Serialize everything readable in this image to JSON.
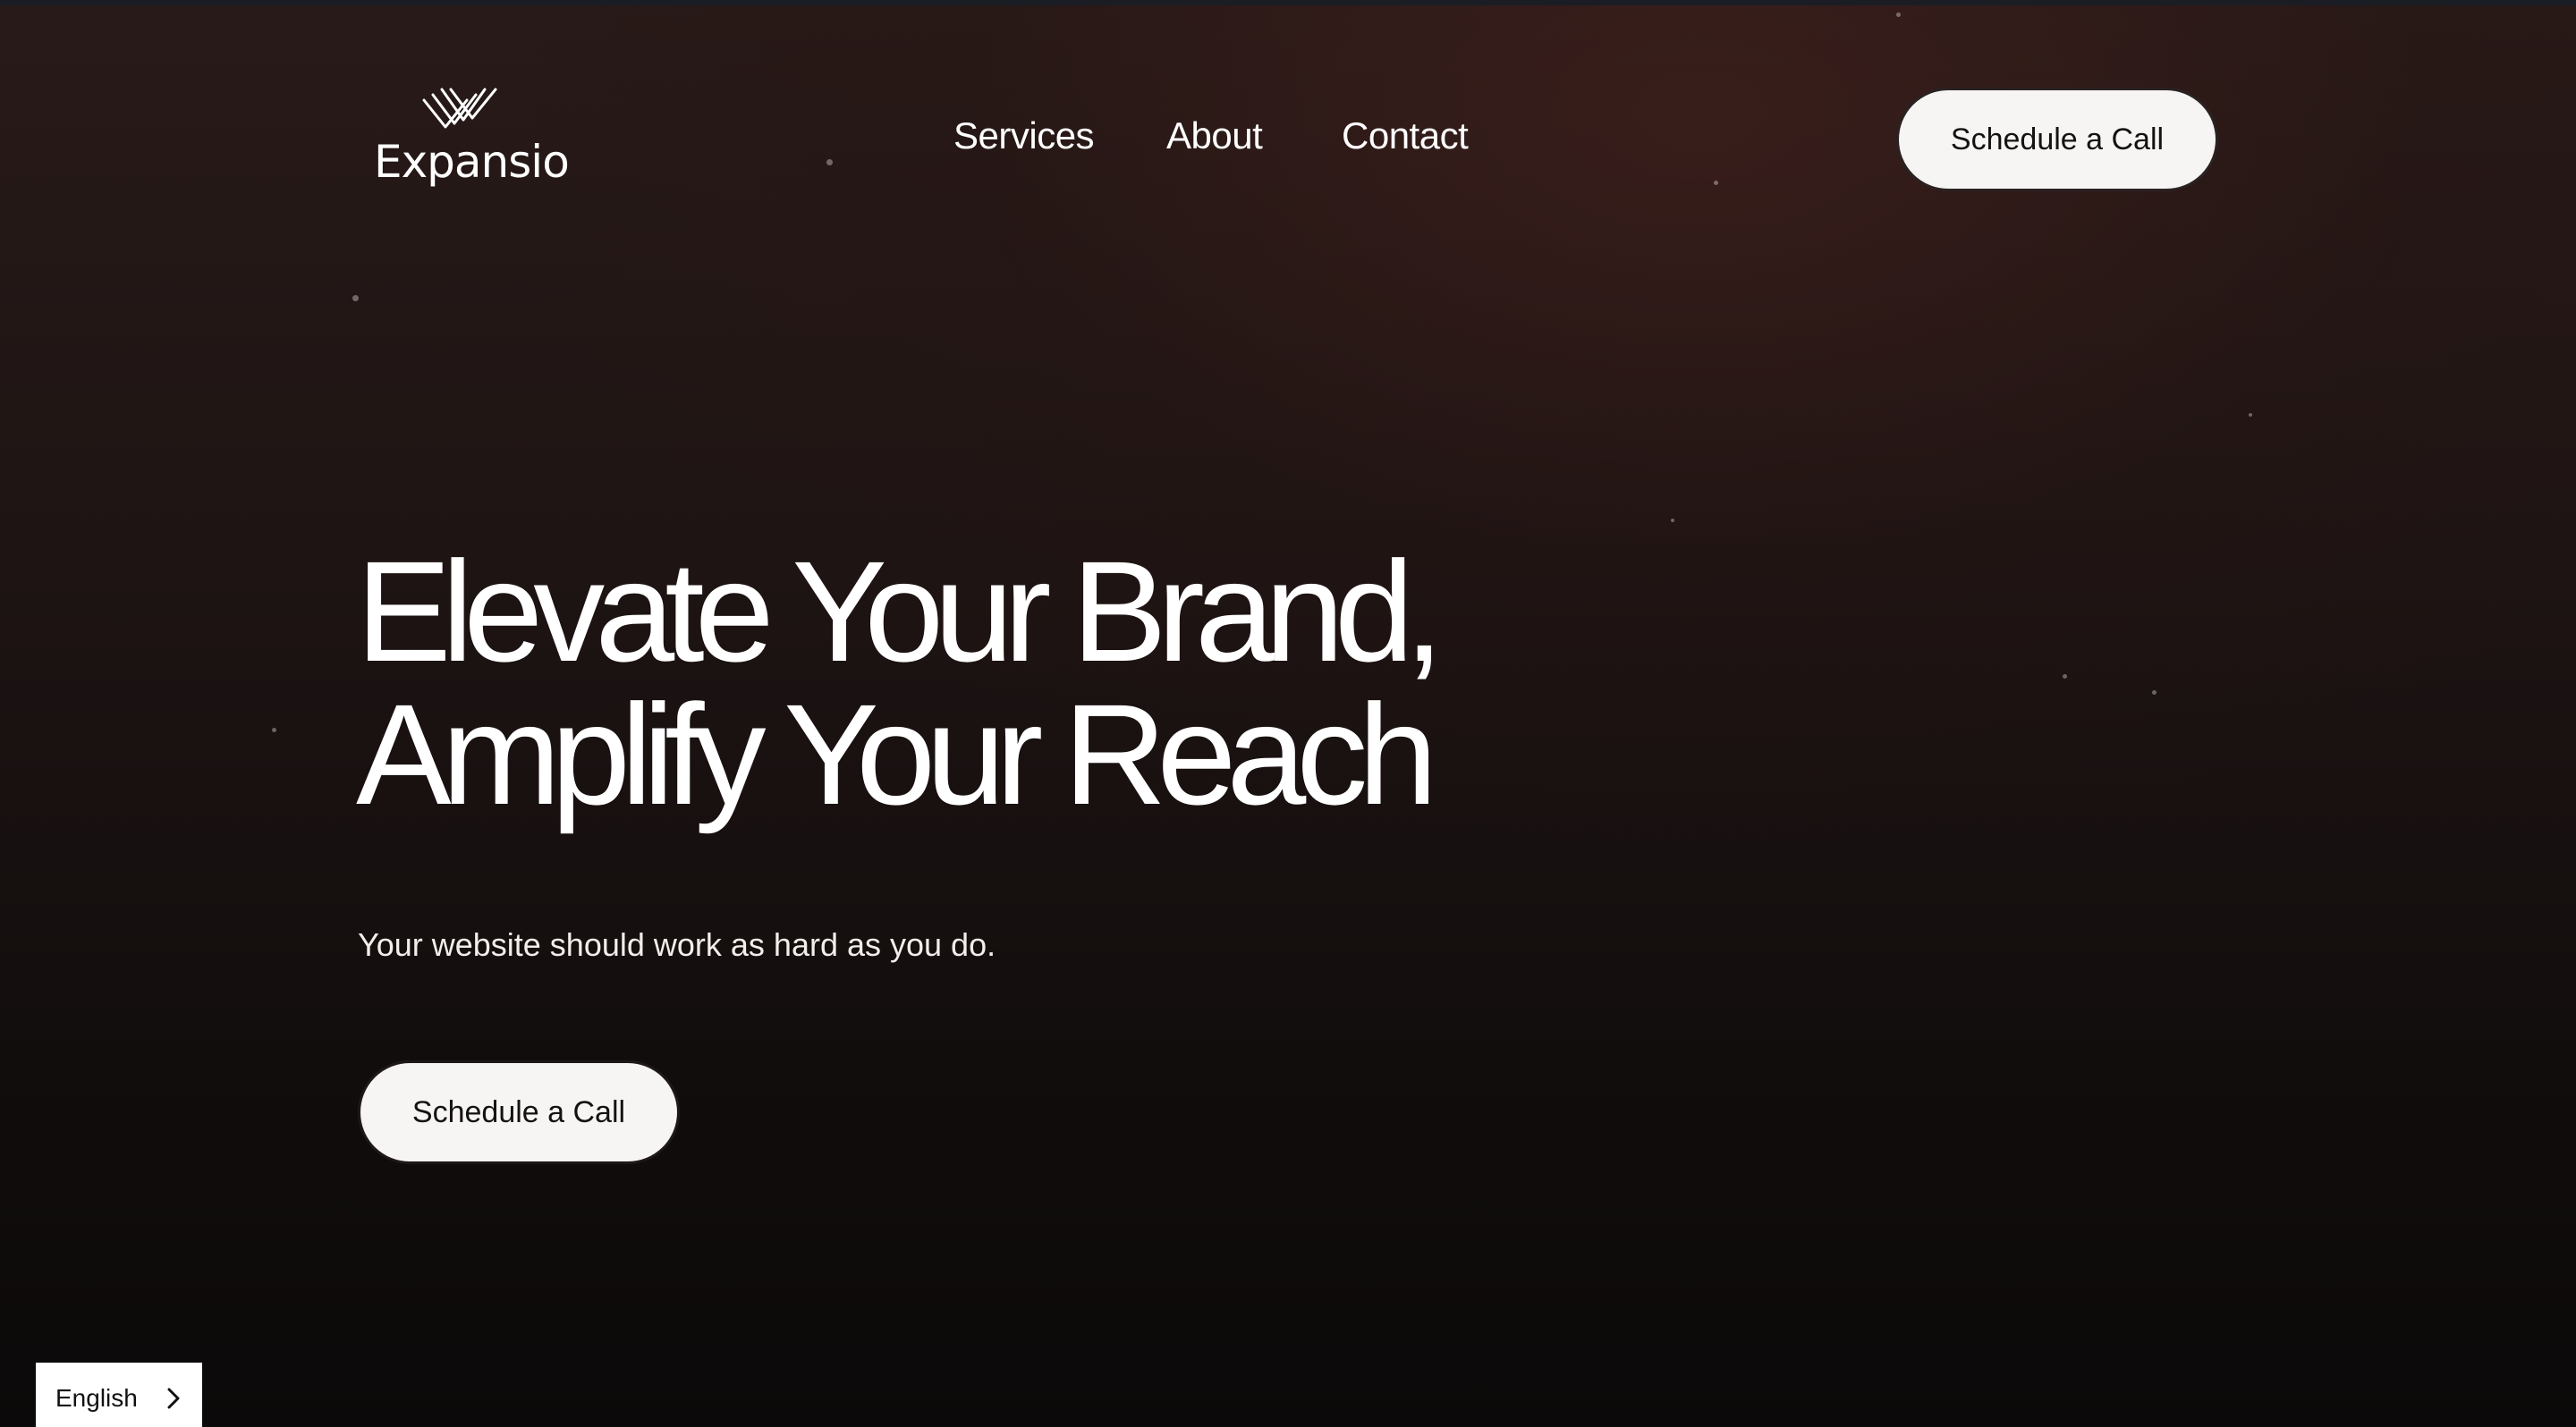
{
  "brand": {
    "name": "Expansio",
    "logo_icon": "chevron-stack-icon"
  },
  "nav": {
    "items": [
      {
        "label": "Services"
      },
      {
        "label": "About"
      },
      {
        "label": "Contact"
      }
    ]
  },
  "header": {
    "cta_label": "Schedule a Call"
  },
  "hero": {
    "title_line_1": "Elevate Your Brand,",
    "title_line_2": "Amplify Your Reach",
    "subtitle": "Your website should work as hard as you do.",
    "cta_label": "Schedule a Call"
  },
  "language_selector": {
    "value": "English",
    "icon": "chevron-right-icon"
  },
  "colors": {
    "background_top": "#281a18",
    "background_bottom": "#0b0909",
    "button_bg": "#f7f5f4",
    "button_text": "#161212",
    "text": "#ffffff"
  }
}
